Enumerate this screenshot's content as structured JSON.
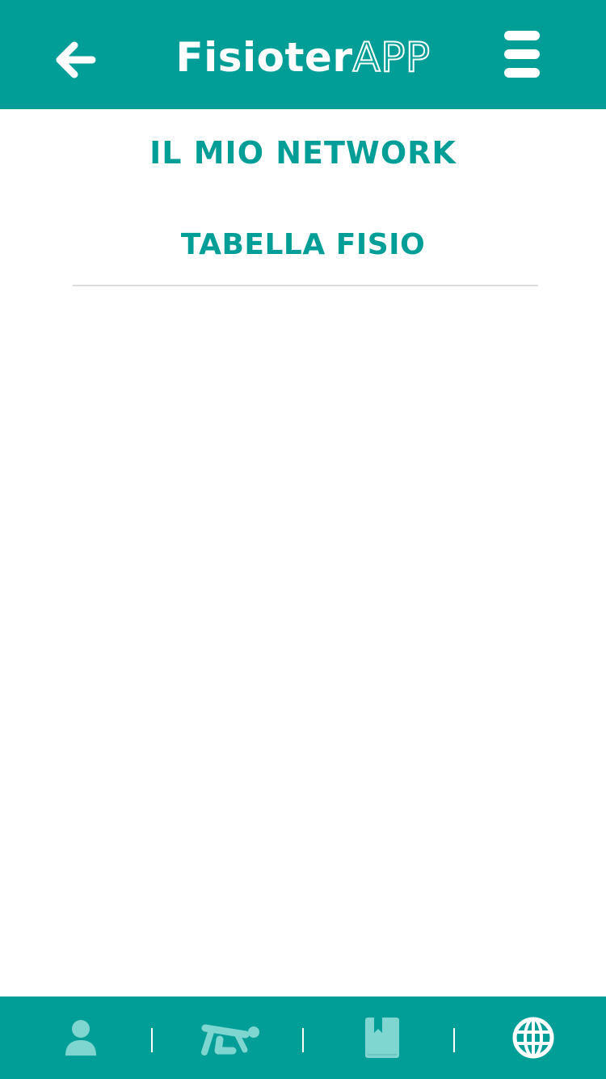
{
  "header": {
    "back_icon": "arrow-left-icon",
    "brand_solid": "Fisioter",
    "brand_outline": "APP",
    "menu_icon": "hamburger-menu-icon"
  },
  "page": {
    "title": "IL MIO NETWORK",
    "section_title": "TABELLA FISIO"
  },
  "bottom_nav": {
    "items": [
      {
        "icon": "user-icon",
        "state": "inactive"
      },
      {
        "icon": "exercise-icon",
        "state": "inactive"
      },
      {
        "icon": "bookmark-book-icon",
        "state": "inactive"
      },
      {
        "icon": "globe-icon",
        "state": "active"
      }
    ]
  },
  "colors": {
    "primary": "#009e97",
    "inactive_icon": "#7fd5cf",
    "active_icon": "#ffffff",
    "divider": "#dcdcdc"
  }
}
